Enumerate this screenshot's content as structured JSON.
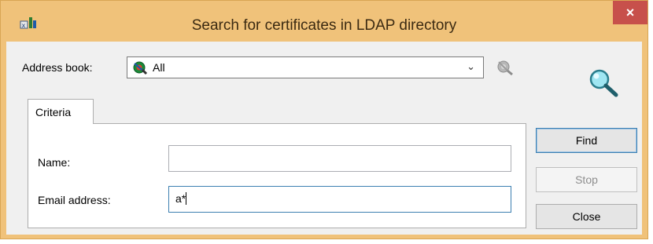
{
  "window": {
    "title": "Search for certificates in LDAP directory",
    "close_glyph": "×",
    "title_icon": "certificate-app-icon"
  },
  "address_book": {
    "label": "Address book:",
    "selected": "All",
    "selected_icon": "address-book-all-icon",
    "dropdown_glyph": "⌄",
    "directory_icon": "directory-settings-icon"
  },
  "decor": {
    "magnifier_icon": "magnifier-icon"
  },
  "tabs": [
    {
      "label": "Criteria",
      "selected": true
    }
  ],
  "criteria": {
    "name_label": "Name:",
    "name_value": "",
    "email_label": "Email address:",
    "email_value": "a*"
  },
  "buttons": {
    "find": "Find",
    "stop": "Stop",
    "close": "Close"
  },
  "colors": {
    "titlebar": "#f0c27a",
    "close_button": "#c7504b",
    "focus_border": "#3c7fb1"
  }
}
